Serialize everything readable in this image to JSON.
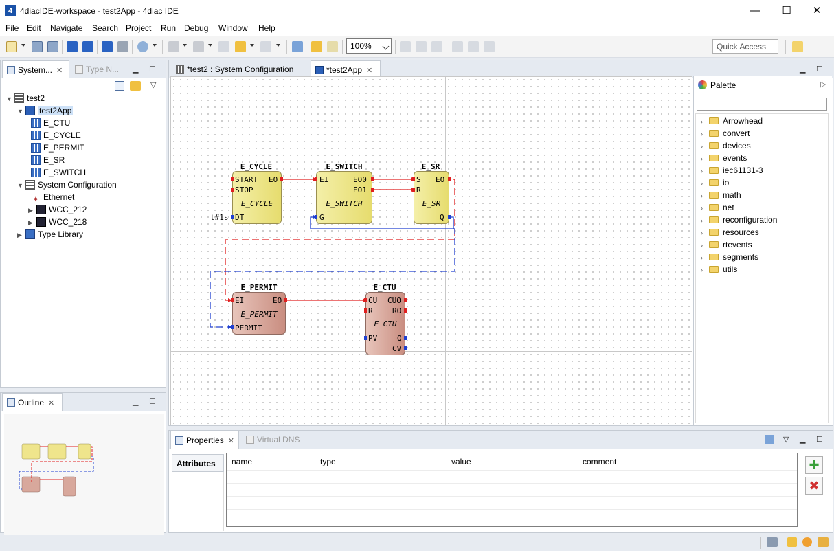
{
  "window": {
    "title": "4diacIDE-workspace - test2App - 4diac IDE",
    "icon_label": "4",
    "controls": {
      "minimize": "—",
      "maximize": "☐",
      "close": "✕"
    }
  },
  "menu": [
    "File",
    "Edit",
    "Navigate",
    "Search",
    "Project",
    "Run",
    "Debug",
    "Window",
    "Help"
  ],
  "toolbar": {
    "zoom": "100%",
    "quick_access": "Quick Access"
  },
  "left_panel": {
    "tabs": [
      {
        "label": "System...",
        "close": "✕"
      },
      {
        "label": "Type N...",
        "close": ""
      }
    ],
    "tree": [
      {
        "label": "test2",
        "depth": 0,
        "expanded": true,
        "icon": "system-icon"
      },
      {
        "label": "test2App",
        "depth": 1,
        "expanded": true,
        "icon": "application-icon",
        "selected": true
      },
      {
        "label": "E_CTU",
        "depth": 2,
        "icon": "function-block-icon"
      },
      {
        "label": "E_CYCLE",
        "depth": 2,
        "icon": "function-block-icon"
      },
      {
        "label": "E_PERMIT",
        "depth": 2,
        "icon": "function-block-icon"
      },
      {
        "label": "E_SR",
        "depth": 2,
        "icon": "function-block-icon"
      },
      {
        "label": "E_SWITCH",
        "depth": 2,
        "icon": "function-block-icon"
      },
      {
        "label": "System Configuration",
        "depth": 1,
        "expanded": true,
        "icon": "system-configuration-icon"
      },
      {
        "label": "Ethernet",
        "depth": 2,
        "icon": "ethernet-icon"
      },
      {
        "label": "WCC_212",
        "depth": 2,
        "collapsed": true,
        "icon": "device-icon"
      },
      {
        "label": "WCC_218",
        "depth": 2,
        "collapsed": true,
        "icon": "device-icon"
      },
      {
        "label": "Type Library",
        "depth": 1,
        "collapsed": true,
        "icon": "type-library-icon"
      }
    ]
  },
  "outline_panel": {
    "tab": "Outline",
    "close": "✕"
  },
  "editor": {
    "tabs": [
      {
        "label": "*test2 : System Configuration",
        "close": ""
      },
      {
        "label": "*test2App",
        "close": "✕"
      }
    ],
    "blocks": {
      "cycle": {
        "name": "E_CYCLE",
        "type": "E_CYCLE",
        "ports": [
          "START",
          "STOP",
          "EO",
          "DT"
        ],
        "param": "t#1s"
      },
      "switch": {
        "name": "E_SWITCH",
        "type": "E_SWITCH",
        "ports": [
          "EI",
          "EO0",
          "EO1",
          "G"
        ]
      },
      "sr": {
        "name": "E_SR",
        "type": "E_SR",
        "ports": [
          "S",
          "R",
          "EO",
          "Q"
        ]
      },
      "permit": {
        "name": "E_PERMIT",
        "type": "E_PERMIT",
        "ports": [
          "EI",
          "EO",
          "PERMIT"
        ]
      },
      "ctu": {
        "name": "E_CTU",
        "type": "E_CTU",
        "ports": [
          "CU",
          "R",
          "CUO",
          "RO",
          "PV",
          "Q",
          "CV"
        ]
      }
    }
  },
  "palette": {
    "title": "Palette",
    "folders": [
      "Arrowhead",
      "convert",
      "devices",
      "events",
      "iec61131-3",
      "io",
      "math",
      "net",
      "reconfiguration",
      "resources",
      "rtevents",
      "segments",
      "utils"
    ]
  },
  "properties": {
    "tabs": [
      {
        "label": "Properties",
        "close": "✕"
      },
      {
        "label": "Virtual DNS"
      }
    ],
    "side_tab": "Attributes",
    "columns": [
      "name",
      "type",
      "value",
      "comment"
    ],
    "add_label": "✚",
    "remove_label": "✖"
  },
  "colors": {
    "event_connection": "#e02020",
    "data_connection": "#2040d0",
    "service_block": "#e6dc6e",
    "event_block": "#c98d80"
  }
}
